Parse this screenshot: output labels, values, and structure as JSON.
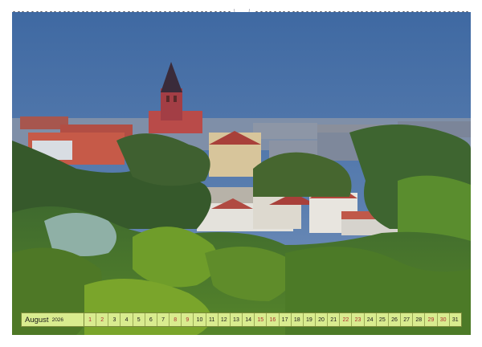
{
  "calendar": {
    "month": "August",
    "year": "2026",
    "days": [
      {
        "n": "1",
        "weekend": true
      },
      {
        "n": "2",
        "weekend": true
      },
      {
        "n": "3",
        "weekend": false
      },
      {
        "n": "4",
        "weekend": false
      },
      {
        "n": "5",
        "weekend": false
      },
      {
        "n": "6",
        "weekend": false
      },
      {
        "n": "7",
        "weekend": false
      },
      {
        "n": "8",
        "weekend": true
      },
      {
        "n": "9",
        "weekend": true
      },
      {
        "n": "10",
        "weekend": false
      },
      {
        "n": "11",
        "weekend": false
      },
      {
        "n": "12",
        "weekend": false
      },
      {
        "n": "13",
        "weekend": false
      },
      {
        "n": "14",
        "weekend": false
      },
      {
        "n": "15",
        "weekend": true
      },
      {
        "n": "16",
        "weekend": true
      },
      {
        "n": "17",
        "weekend": false
      },
      {
        "n": "18",
        "weekend": false
      },
      {
        "n": "19",
        "weekend": false
      },
      {
        "n": "20",
        "weekend": false
      },
      {
        "n": "21",
        "weekend": false
      },
      {
        "n": "22",
        "weekend": true
      },
      {
        "n": "23",
        "weekend": true
      },
      {
        "n": "24",
        "weekend": false
      },
      {
        "n": "25",
        "weekend": false
      },
      {
        "n": "26",
        "weekend": false
      },
      {
        "n": "27",
        "weekend": false
      },
      {
        "n": "28",
        "weekend": false
      },
      {
        "n": "29",
        "weekend": true
      },
      {
        "n": "30",
        "weekend": true
      },
      {
        "n": "31",
        "weekend": false
      }
    ]
  },
  "colors": {
    "sky": "#4f72a3",
    "calendar_bg": "#d9ec8f",
    "weekend_text": "#b03030",
    "roof": "#a8403a"
  },
  "photo": {
    "icon": "landscape-photo"
  }
}
